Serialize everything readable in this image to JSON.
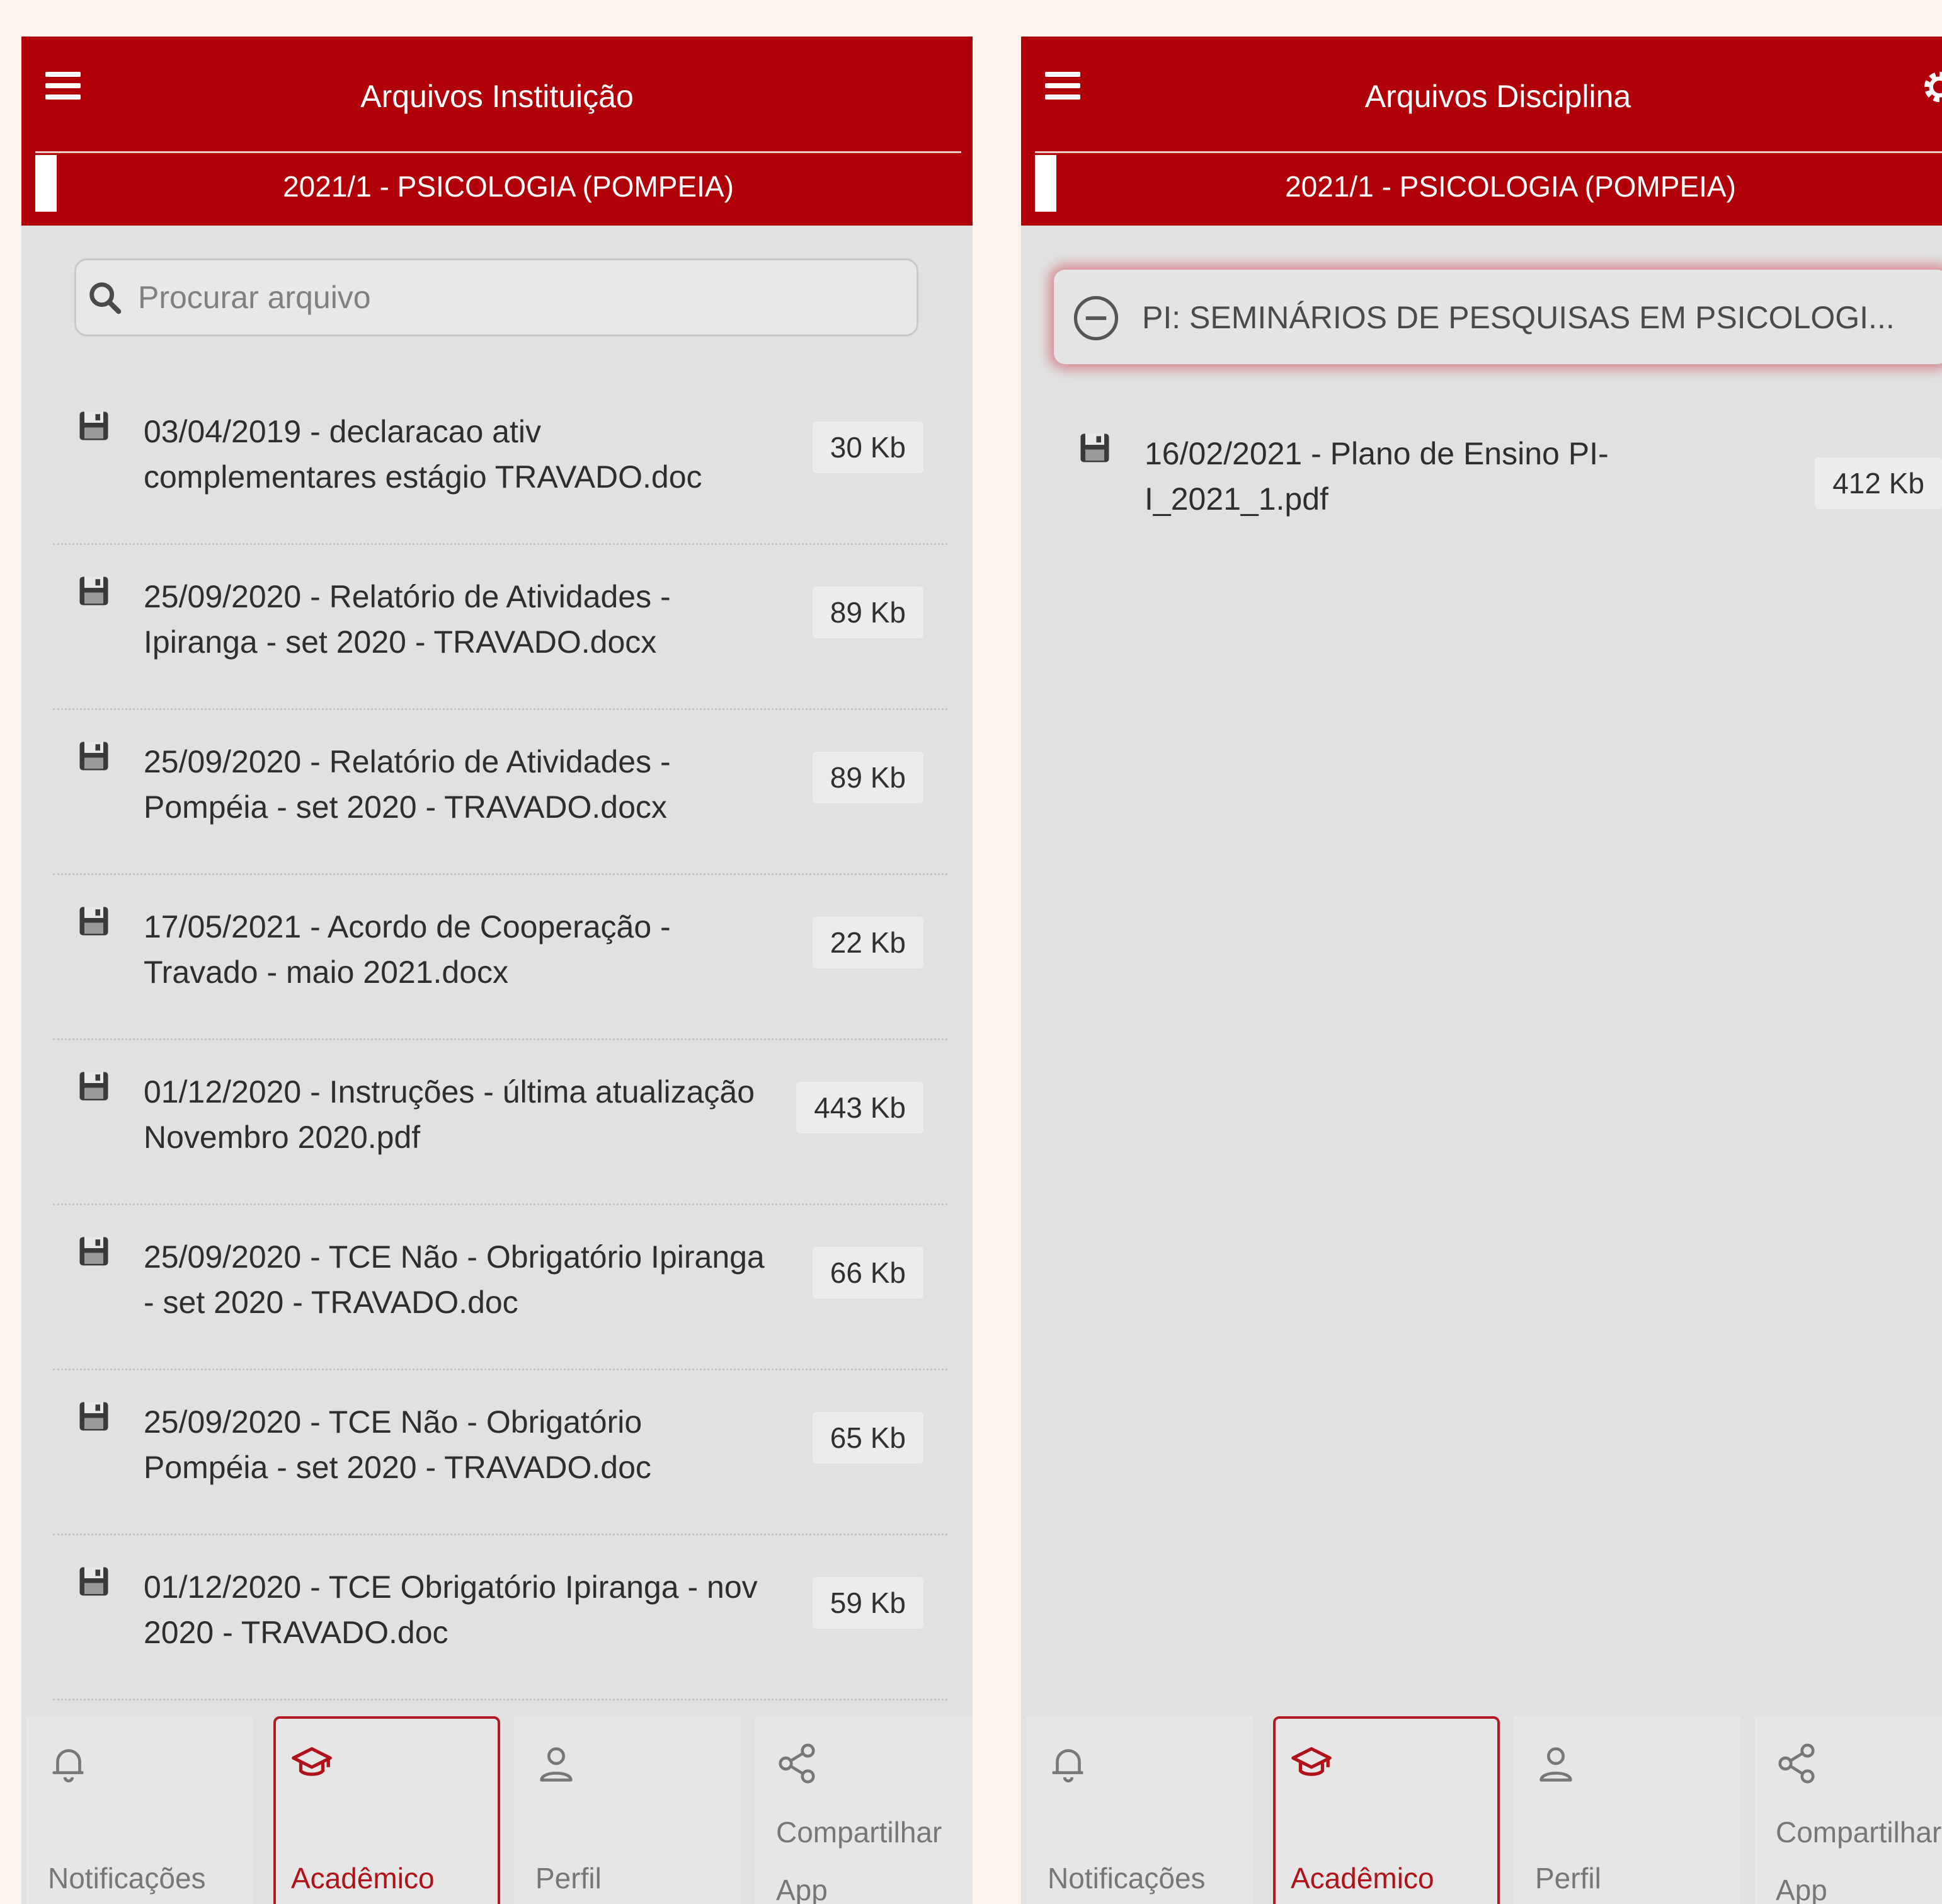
{
  "colors": {
    "brand_red": "#b00008",
    "active_tab": "#b0121a",
    "panel_bg": "#e1e1e1",
    "page_bg": "#fdf5ec"
  },
  "left_screen": {
    "title": "Arquivos Instituição",
    "term": "2021/1 - PSICOLOGIA (POMPEIA)",
    "search": {
      "placeholder": "Procurar arquivo",
      "value": ""
    },
    "files": [
      {
        "name": "03/04/2019 - declaracao ativ complementares estágio TRAVADO.doc",
        "size": "30 Kb",
        "icon": "save-icon"
      },
      {
        "name": "25/09/2020 - Relatório de Atividades - Ipiranga - set 2020 - TRAVADO.docx",
        "size": "89 Kb",
        "icon": "save-icon"
      },
      {
        "name": "25/09/2020 - Relatório de Atividades - Pompéia - set 2020 - TRAVADO.docx",
        "size": "89 Kb",
        "icon": "save-icon"
      },
      {
        "name": "17/05/2021 - Acordo de Cooperação - Travado - maio 2021.docx",
        "size": "22 Kb",
        "icon": "save-icon"
      },
      {
        "name": "01/12/2020 - Instruções - última atualização Novembro 2020.pdf",
        "size": "443 Kb",
        "icon": "save-icon"
      },
      {
        "name": "25/09/2020 - TCE Não - Obrigatório Ipiranga - set 2020 - TRAVADO.doc",
        "size": "66 Kb",
        "icon": "save-icon"
      },
      {
        "name": "25/09/2020 - TCE Não - Obrigatório Pompéia - set 2020 - TRAVADO.doc",
        "size": "65 Kb",
        "icon": "save-icon"
      },
      {
        "name": "01/12/2020 - TCE Obrigatório Ipiranga - nov 2020 - TRAVADO.doc",
        "size": "59 Kb",
        "icon": "save-icon"
      }
    ],
    "nav": [
      {
        "label": "Notificações",
        "icon": "bell-icon",
        "active": false
      },
      {
        "label": "Acadêmico",
        "icon": "graduation-cap-icon",
        "active": true
      },
      {
        "label": "Perfil",
        "icon": "user-icon",
        "active": false
      },
      {
        "label_line1": "Compartilhar",
        "label_line2": "App",
        "icon": "share-icon",
        "active": false
      }
    ]
  },
  "right_screen": {
    "title": "Arquivos Disciplina",
    "term": "2021/1 - PSICOLOGIA (POMPEIA)",
    "discipline": "PI: SEMINÁRIOS DE PESQUISAS EM PSICOLOGI...",
    "files": [
      {
        "name": "16/02/2021 - Plano de Ensino PI-I_2021_1.pdf",
        "size": "412 Kb",
        "icon": "save-icon"
      }
    ],
    "nav": [
      {
        "label": "Notificações",
        "icon": "bell-icon",
        "active": false
      },
      {
        "label": "Acadêmico",
        "icon": "graduation-cap-icon",
        "active": true
      },
      {
        "label": "Perfil",
        "icon": "user-icon",
        "active": false
      },
      {
        "label_line1": "Compartilhar",
        "label_line2": "App",
        "icon": "share-icon",
        "active": false
      }
    ]
  }
}
